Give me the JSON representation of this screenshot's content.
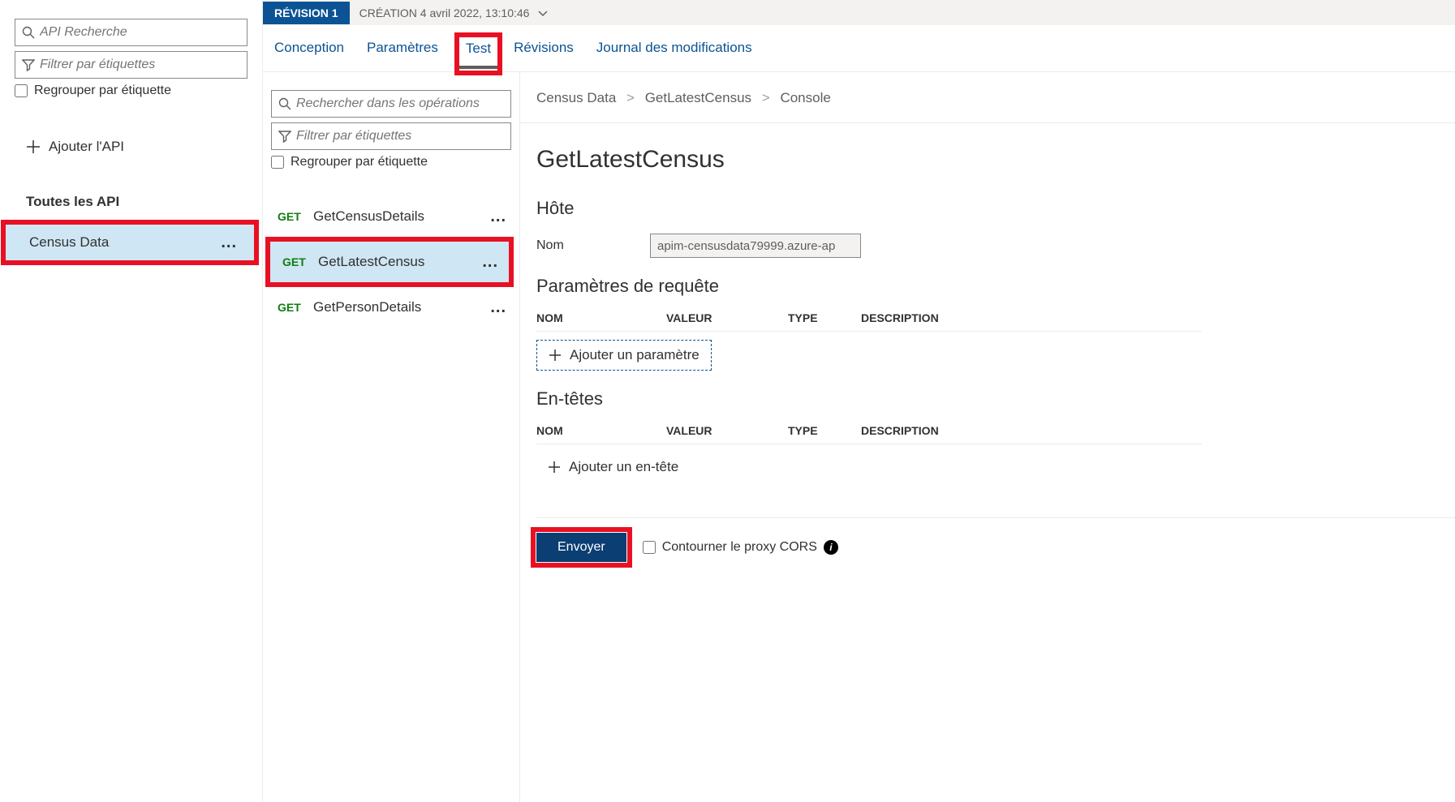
{
  "sidebar": {
    "search_placeholder": "API Recherche",
    "filter_placeholder": "Filtrer par étiquettes",
    "group_by_tag_label": "Regrouper par étiquette",
    "add_api_label": "Ajouter l'API",
    "all_apis_label": "Toutes les API",
    "apis": [
      {
        "name": "Census Data"
      }
    ]
  },
  "revision": {
    "badge": "RÉVISION 1",
    "creation_text": "CRÉATION 4 avril 2022, 13:10:46"
  },
  "tabs": [
    {
      "label": "Conception"
    },
    {
      "label": "Paramètres"
    },
    {
      "label": "Test"
    },
    {
      "label": "Révisions"
    },
    {
      "label": "Journal des modifications"
    }
  ],
  "operations_panel": {
    "search_placeholder": "Rechercher dans les opérations",
    "filter_placeholder": "Filtrer par étiquettes",
    "group_by_tag_label": "Regrouper par étiquette",
    "operations": [
      {
        "method": "GET",
        "name": "GetCensusDetails"
      },
      {
        "method": "GET",
        "name": "GetLatestCensus"
      },
      {
        "method": "GET",
        "name": "GetPersonDetails"
      }
    ]
  },
  "breadcrumb": {
    "part1": "Census Data",
    "part2": "GetLatestCensus",
    "part3": "Console"
  },
  "detail": {
    "title": "GetLatestCensus",
    "host_heading": "Hôte",
    "name_label": "Nom",
    "host_value": "apim-censusdata79999.azure-ap",
    "query_heading": "Paramètres de requête",
    "headers_heading": "En-têtes",
    "table_headers": {
      "col1": "NOM",
      "col2": "VALEUR",
      "col3": "TYPE",
      "col4": "DESCRIPTION"
    },
    "add_param_label": "Ajouter un paramètre",
    "add_header_label": "Ajouter un en-tête",
    "send_label": "Envoyer",
    "cors_label": "Contourner le proxy CORS"
  }
}
